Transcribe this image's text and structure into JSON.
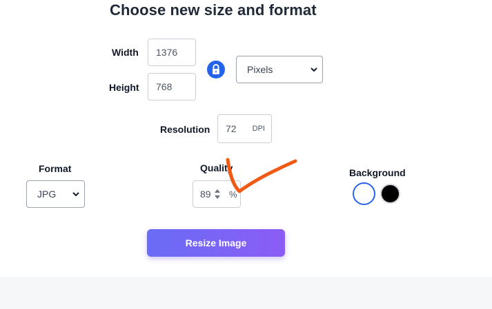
{
  "title": "Choose new size and format",
  "size": {
    "width_label": "Width",
    "width_value": "1376",
    "height_label": "Height",
    "height_value": "768",
    "lock_icon": "lock-icon",
    "unit_selected": "Pixels"
  },
  "resolution": {
    "label": "Resolution",
    "value": "72",
    "unit": "DPI"
  },
  "format": {
    "label": "Format",
    "selected": "JPG"
  },
  "quality": {
    "label": "Quality",
    "value": "89",
    "unit": "%"
  },
  "background": {
    "label": "Background",
    "options": [
      "white",
      "black"
    ],
    "selected": "white",
    "colors": {
      "white": "#ffffff",
      "black": "#000000",
      "selected_ring": "#2563eb"
    }
  },
  "actions": {
    "resize_label": "Resize Image"
  },
  "colors": {
    "accent": "#2563eb",
    "button_gradient_start": "#6a6cf6",
    "button_gradient_end": "#8b5cf6",
    "annotation": "#f05a14"
  }
}
